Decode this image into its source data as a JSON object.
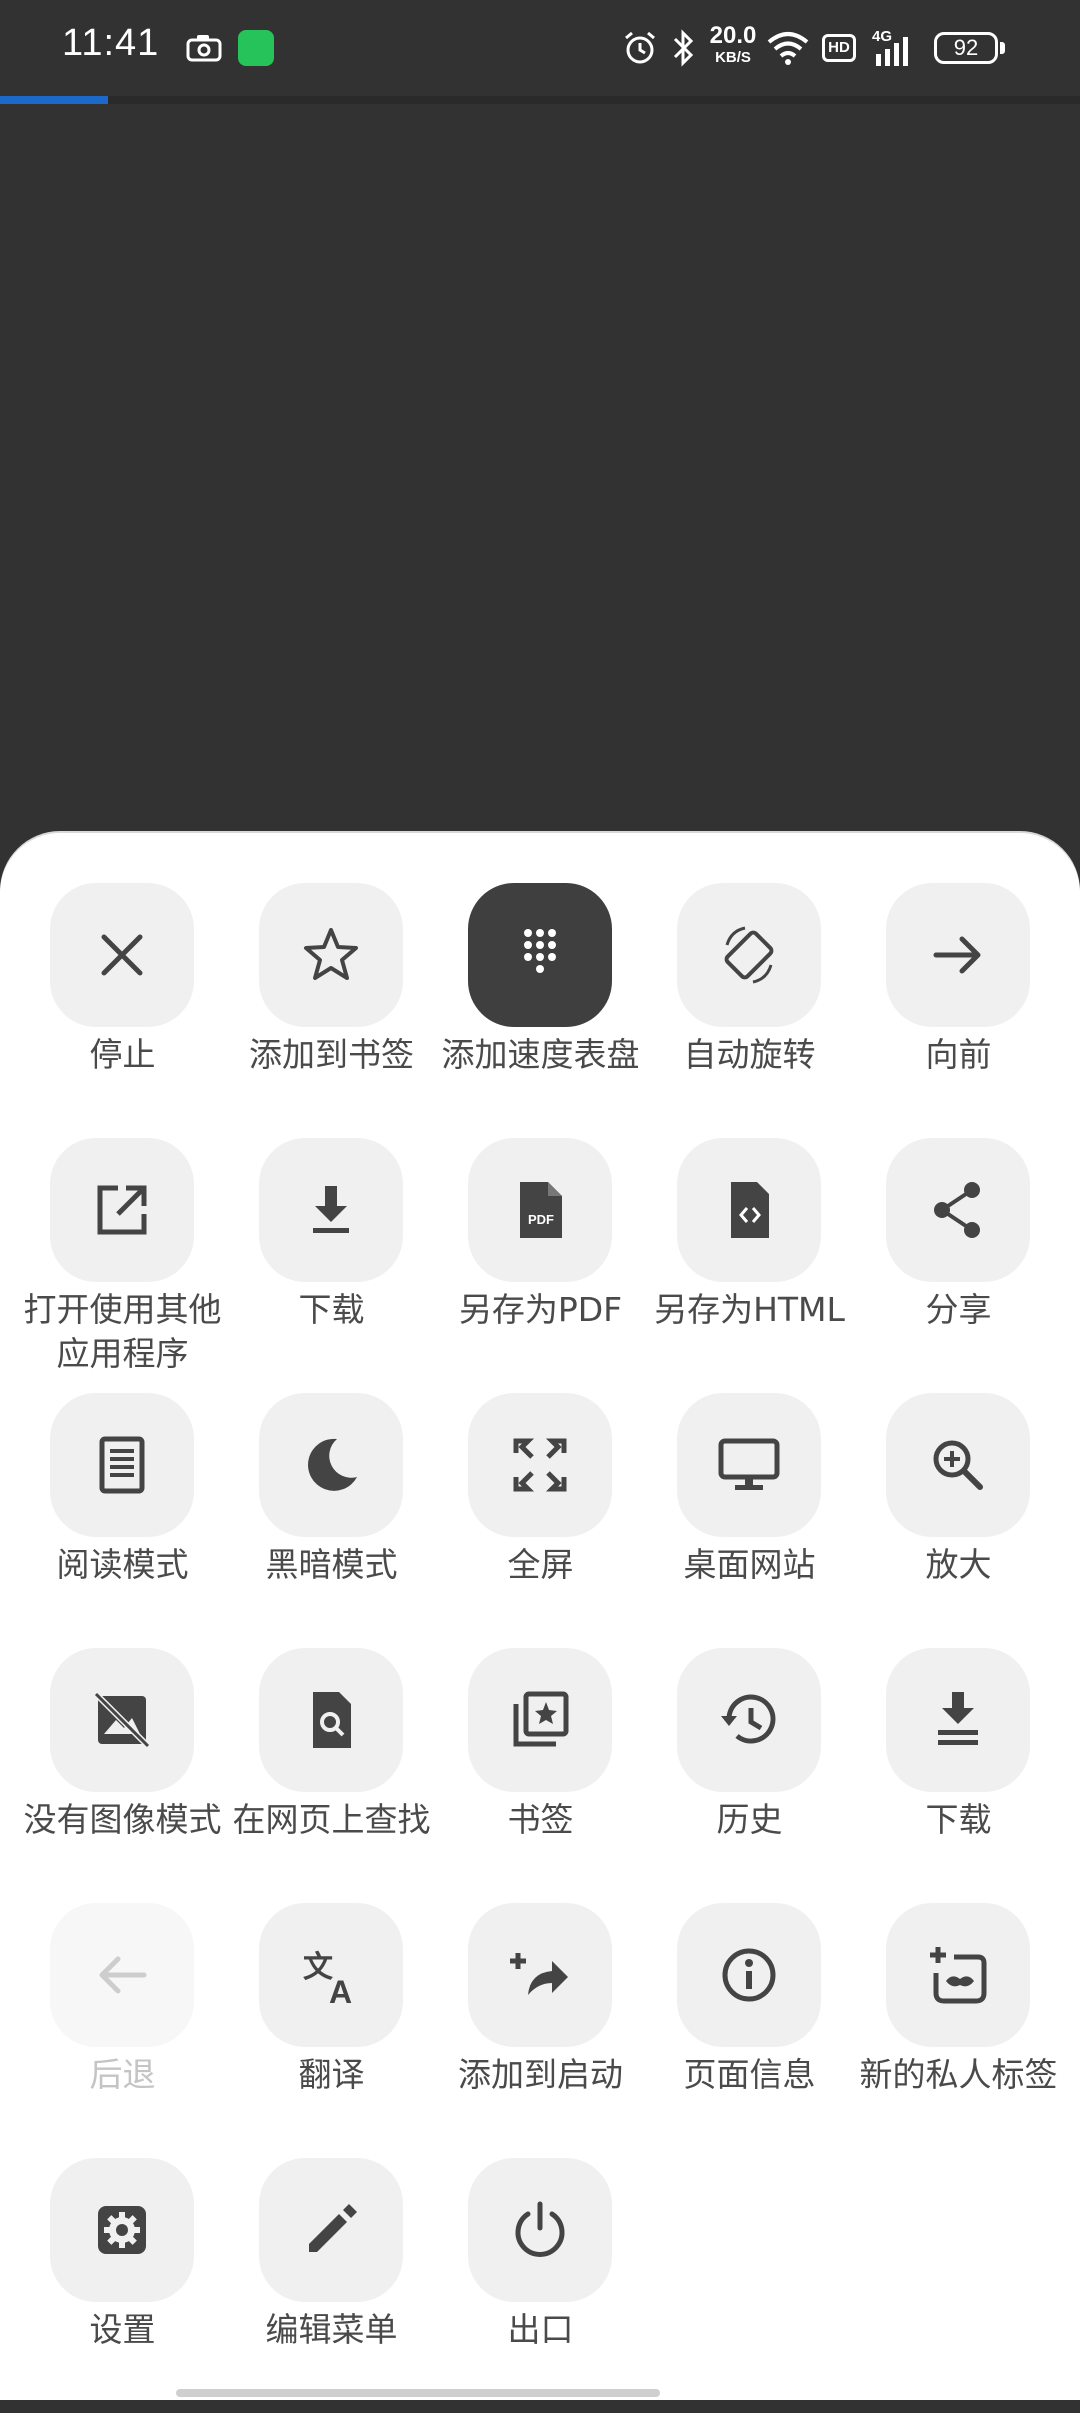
{
  "status_bar": {
    "time": "11:41",
    "net_speed_value": "20.0",
    "net_speed_unit": "KB/S",
    "hd_label": "HD",
    "network_type": "4G",
    "battery": "92"
  },
  "page_load_progress": 0.1,
  "menu": {
    "items": [
      {
        "label": "停止",
        "icon": "close-icon"
      },
      {
        "label": "添加到书签",
        "icon": "star-outline-icon"
      },
      {
        "label": "添加速度表盘",
        "icon": "speed-dial-icon"
      },
      {
        "label": "自动旋转",
        "icon": "screen-rotation-icon"
      },
      {
        "label": "向前",
        "icon": "arrow-forward-icon"
      },
      {
        "label": "打开使用其他应用程序",
        "icon": "open-external-icon"
      },
      {
        "label": "下载",
        "icon": "download-icon"
      },
      {
        "label": "另存为PDF",
        "icon": "pdf-file-icon"
      },
      {
        "label": "另存为HTML",
        "icon": "code-file-icon"
      },
      {
        "label": "分享",
        "icon": "share-icon"
      },
      {
        "label": "阅读模式",
        "icon": "reader-mode-icon"
      },
      {
        "label": "黑暗模式",
        "icon": "moon-icon"
      },
      {
        "label": "全屏",
        "icon": "fullscreen-icon"
      },
      {
        "label": "桌面网站",
        "icon": "desktop-icon"
      },
      {
        "label": "放大",
        "icon": "zoom-in-icon"
      },
      {
        "label": "没有图像模式",
        "icon": "no-image-icon"
      },
      {
        "label": "在网页上查找",
        "icon": "find-in-page-icon"
      },
      {
        "label": "书签",
        "icon": "bookmarks-icon"
      },
      {
        "label": "历史",
        "icon": "history-icon"
      },
      {
        "label": "下载",
        "icon": "downloads-list-icon"
      },
      {
        "label": "后退",
        "icon": "arrow-back-icon"
      },
      {
        "label": "翻译",
        "icon": "translate-icon"
      },
      {
        "label": "添加到启动",
        "icon": "add-to-startup-icon"
      },
      {
        "label": "页面信息",
        "icon": "info-icon"
      },
      {
        "label": "新的私人标签",
        "icon": "incognito-tab-icon"
      },
      {
        "label": "设置",
        "icon": "settings-gear-icon"
      },
      {
        "label": "编辑菜单",
        "icon": "edit-pencil-icon"
      },
      {
        "label": "出口",
        "icon": "power-icon"
      }
    ]
  }
}
